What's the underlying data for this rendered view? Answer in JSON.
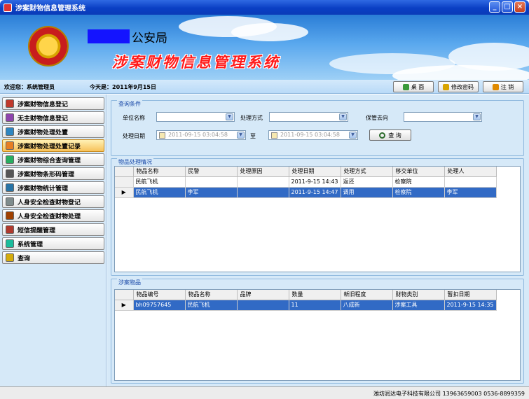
{
  "window": {
    "title": "涉案财物信息管理系统"
  },
  "banner": {
    "bureau": "公安局",
    "system_title": "涉案财物信息管理系统"
  },
  "status": {
    "welcome": "欢迎您：系统管理员",
    "today": "今天是：2011年9月15日"
  },
  "toolbar": {
    "desktop": "桌 面",
    "change_password": "修改密码",
    "logout": "注 销"
  },
  "sidebar": {
    "items": [
      {
        "label": "涉案财物信息登记",
        "color": "#c0392b"
      },
      {
        "label": "无主财物信息登记",
        "color": "#8e44ad"
      },
      {
        "label": "涉案财物处理处置",
        "color": "#2e86c1"
      },
      {
        "label": "涉案财物处理处置记录",
        "color": "#e67e22"
      },
      {
        "label": "涉案财物综合查询管理",
        "color": "#27ae60"
      },
      {
        "label": "涉案财物条形码管理",
        "color": "#555555"
      },
      {
        "label": "涉案财物统计管理",
        "color": "#2874a6"
      },
      {
        "label": "人身安全检查财物登记",
        "color": "#7f8c8d"
      },
      {
        "label": "人身安全检查财物处理",
        "color": "#a04000"
      },
      {
        "label": "短信提醒管理",
        "color": "#b03a2e"
      },
      {
        "label": "系统管理",
        "color": "#1abc9c"
      },
      {
        "label": "查询",
        "color": "#d4ac0d"
      }
    ],
    "active_index": 3
  },
  "query": {
    "title": "查询条件",
    "unit_label": "单位名称",
    "method_label": "处理方式",
    "destination_label": "保管去向",
    "date_label": "处理日期",
    "date_from": "2011-09-15 03:04:58",
    "to_label": "至",
    "date_to": "2011-09-15 03:04:58",
    "search_button": "查 询"
  },
  "disposal": {
    "title": "物品处理情况",
    "columns": [
      "物品名称",
      "民警",
      "处理原因",
      "处理日期",
      "处理方式",
      "移交单位",
      "处理人"
    ],
    "rows": [
      [
        "民航飞机",
        "",
        "",
        "2011-9-15 14:43",
        "返还",
        "检察院",
        ""
      ],
      [
        "民航飞机",
        "李军",
        "",
        "2011-9-15 14:47",
        "调用",
        "检察院",
        "李军"
      ]
    ],
    "selected_row": 1
  },
  "items": {
    "title": "涉案物品",
    "columns": [
      "物品编号",
      "物品名称",
      "品牌",
      "数量",
      "新旧程度",
      "财物类别",
      "暂扣日期"
    ],
    "rows": [
      [
        "bh09757645",
        "民航飞机",
        "",
        "11",
        "八成新",
        "涉案工具",
        "2011-9-15 14:35"
      ]
    ],
    "selected_row": 0
  },
  "footer": {
    "copyright": "潍坊润达电子科技有限公司 13963659003 0536-8899359"
  },
  "colors": {
    "accent": "#316ac5",
    "titlebar": "#0a3fc4",
    "panel": "#d6e9f8",
    "title_red": "#ff1a1a"
  }
}
